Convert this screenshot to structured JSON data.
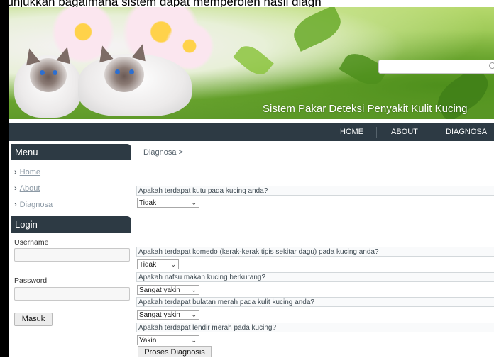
{
  "caption_top": "nunjukkan bagaimana sistem dapat memperoleh hasil diagn",
  "header": {
    "site_title": "Sistem Pakar Deteksi Penyakit Kulit Kucing",
    "search": {
      "placeholder": ""
    }
  },
  "nav": {
    "items": [
      "HOME",
      "ABOUT",
      "DIAGNOSA"
    ]
  },
  "sidebar": {
    "menu_title": "Menu",
    "links": [
      "Home",
      "About",
      "Diagnosa"
    ],
    "login_title": "Login",
    "username_label": "Username",
    "password_label": "Password",
    "login_button": "Masuk"
  },
  "main": {
    "breadcrumb": "Diagnosa >",
    "questions": [
      {
        "text": "Apakah terdapat kutu pada kucing anda?",
        "answer": "Tidak"
      },
      {
        "text": "Apakah terdapat komedo (kerak-kerak tipis sekitar dagu) pada kucing anda?",
        "answer": "Tidak"
      },
      {
        "text": "Apakah nafsu makan kucing berkurang?",
        "answer": "Sangat yakin"
      },
      {
        "text": "Apakah terdapat bulatan merah pada kulit kucing anda?",
        "answer": "Sangat yakin"
      },
      {
        "text": "Apakah terdapat lendir merah pada kucing?",
        "answer": "Yakin"
      }
    ],
    "submit_button": "Proses Diagnosis"
  },
  "colors": {
    "navbar": "#2d3a44",
    "sidebar_header": "#2d3a44",
    "link": "#8d9aa6"
  }
}
